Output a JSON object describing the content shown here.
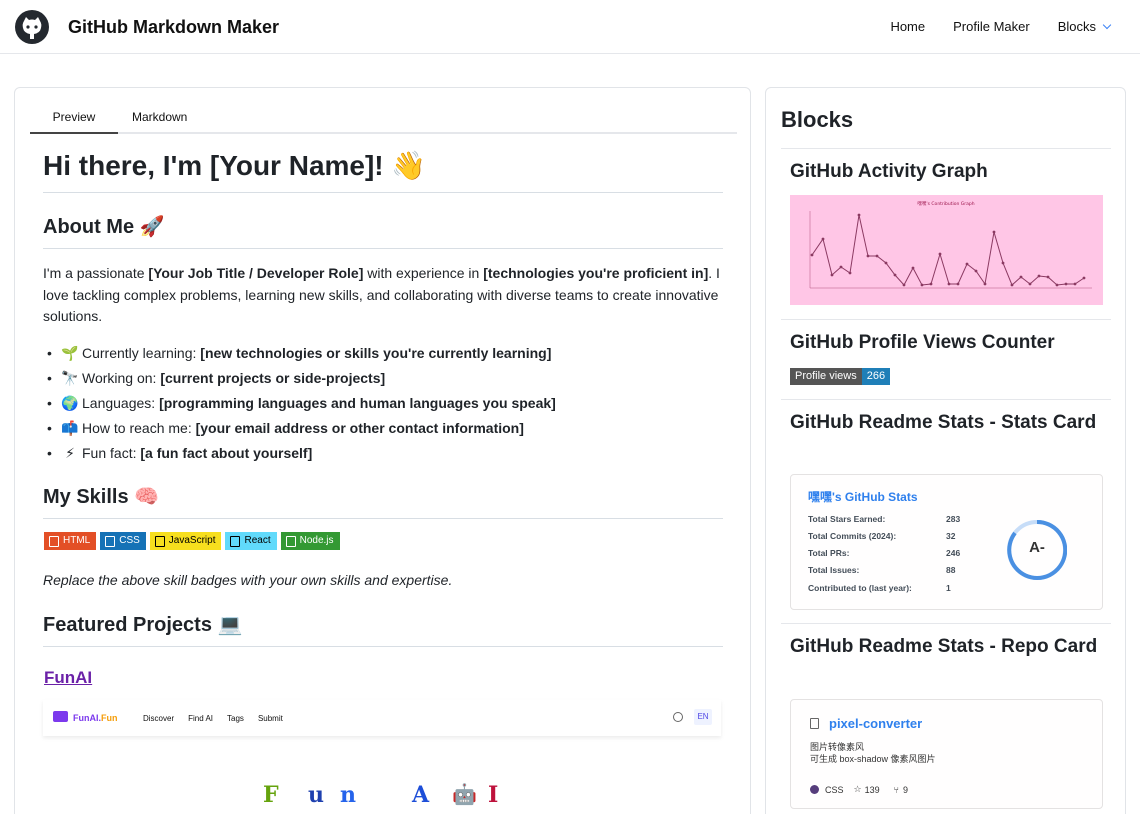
{
  "header": {
    "brand": "GitHub Markdown Maker",
    "nav": {
      "home": "Home",
      "profile_maker": "Profile Maker",
      "blocks": "Blocks"
    }
  },
  "editor": {
    "tabs": {
      "preview": "Preview",
      "markdown": "Markdown"
    },
    "h1": "Hi there, I'm [Your Name]! 👋",
    "about_title": "About Me 🚀",
    "about": {
      "p1": "I'm a passionate ",
      "b1": "[Your Job Title / Developer Role]",
      "p2": " with experience in ",
      "b2": "[technologies you're proficient in]",
      "p3": ". I love tackling complex problems, learning new skills, and collaborating with diverse teams to create innovative solutions."
    },
    "list": [
      {
        "emoji": "🌱",
        "label": "Currently learning: ",
        "value": "[new technologies or skills you're currently learning]"
      },
      {
        "emoji": "🔭",
        "label": "Working on: ",
        "value": "[current projects or side-projects]"
      },
      {
        "emoji": "🌍",
        "label": "Languages: ",
        "value": "[programming languages and human languages you speak]"
      },
      {
        "emoji": "📫",
        "label": "How to reach me: ",
        "value": "[your email address or other contact information]"
      },
      {
        "emoji": "⚡",
        "label": "Fun fact: ",
        "value": "[a fun fact about yourself]"
      }
    ],
    "skills_title": "My Skills 🧠",
    "badges": [
      {
        "label": "HTML",
        "color": "#e34f26",
        "text_color": "#ffffff"
      },
      {
        "label": "CSS",
        "color": "#1572b6",
        "text_color": "#ffffff"
      },
      {
        "label": "JavaScript",
        "color": "#f7df1e",
        "text_color": "#000000"
      },
      {
        "label": "React",
        "color": "#61dafb",
        "text_color": "#000000"
      },
      {
        "label": "Node.js",
        "color": "#339933",
        "text_color": "#ffffff"
      }
    ],
    "skills_note": "Replace the above skill badges with your own skills and expertise.",
    "projects_title": "Featured Projects 💻",
    "project_link": "FunAI",
    "funai_shot": {
      "brand_a": "FunAI.",
      "brand_b": "Fun",
      "nav": [
        "Discover",
        "Find AI",
        "Tags",
        "Submit"
      ],
      "lang": "EN",
      "letters": [
        "F",
        "u",
        "n",
        "A",
        "🤖",
        "I"
      ]
    }
  },
  "blocks": {
    "title": "Blocks",
    "activity_title": "GitHub Activity Graph",
    "activity_graph_title": "嘿嘿's Contribution Graph",
    "views_title": "GitHub Profile Views Counter",
    "views_label": "Profile views",
    "views_count": "266",
    "stats_title": "GitHub Readme Stats - Stats Card",
    "stats": {
      "card_title": "嘿嘿's GitHub Stats",
      "rows": [
        {
          "k": "Total Stars Earned:",
          "v": "283"
        },
        {
          "k": "Total Commits (2024):",
          "v": "32"
        },
        {
          "k": "Total PRs:",
          "v": "246"
        },
        {
          "k": "Total Issues:",
          "v": "88"
        },
        {
          "k": "Contributed to (last year):",
          "v": "1"
        }
      ],
      "grade": "A-"
    },
    "repo_title": "GitHub Readme Stats - Repo Card",
    "repo": {
      "name": "pixel-converter",
      "desc_1": "图片转像素风",
      "desc_2": "可生成 box-shadow 像素风图片",
      "lang": "CSS",
      "stars": "139",
      "forks": "9",
      "lang_color": "#563d7c"
    }
  }
}
